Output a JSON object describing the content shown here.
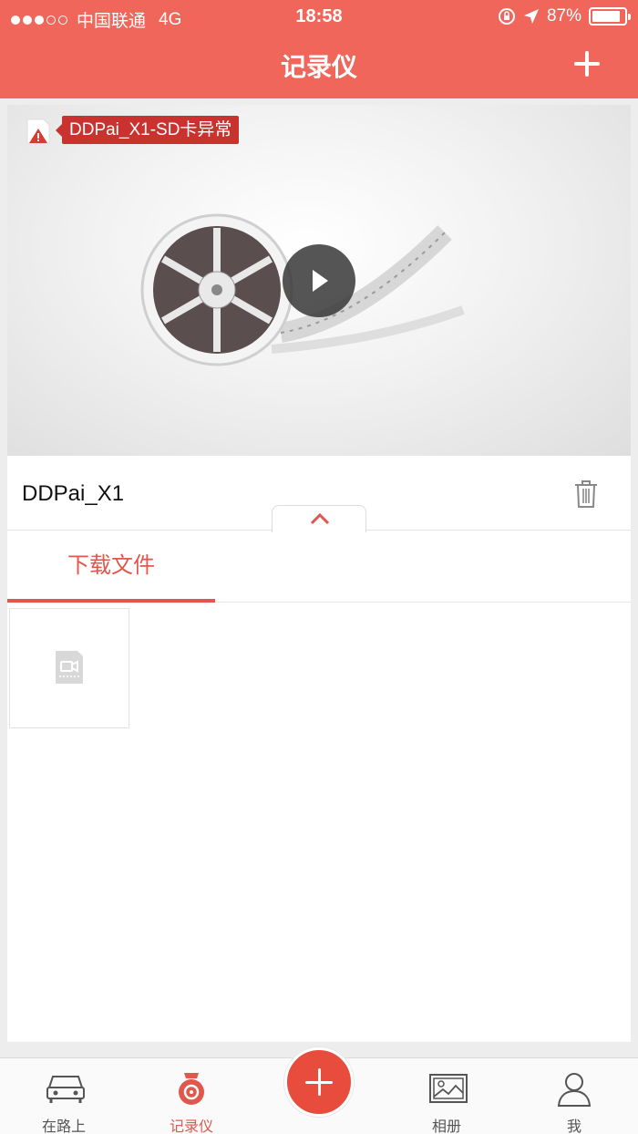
{
  "status_bar": {
    "carrier": "中国联通",
    "network": "4G",
    "time": "18:58",
    "battery": "87%",
    "battery_level": 0.87
  },
  "header": {
    "title": "记录仪"
  },
  "camera_card": {
    "warning": "DDPai_X1-SD卡异常",
    "device_name": "DDPai_X1"
  },
  "tabs": [
    {
      "label": "下载文件",
      "active": true
    }
  ],
  "tab_bar": {
    "items": [
      {
        "label": "在路上",
        "icon": "car-icon"
      },
      {
        "label": "记录仪",
        "icon": "dashcam-icon",
        "active": true
      },
      {
        "label": "",
        "icon": "add-icon"
      },
      {
        "label": "相册",
        "icon": "photo-album-icon"
      },
      {
        "label": "我",
        "icon": "user-icon"
      }
    ]
  },
  "colors": {
    "accent": "#f0665a",
    "active_tab": "#e0574c",
    "warning_bg": "#c8332f"
  }
}
